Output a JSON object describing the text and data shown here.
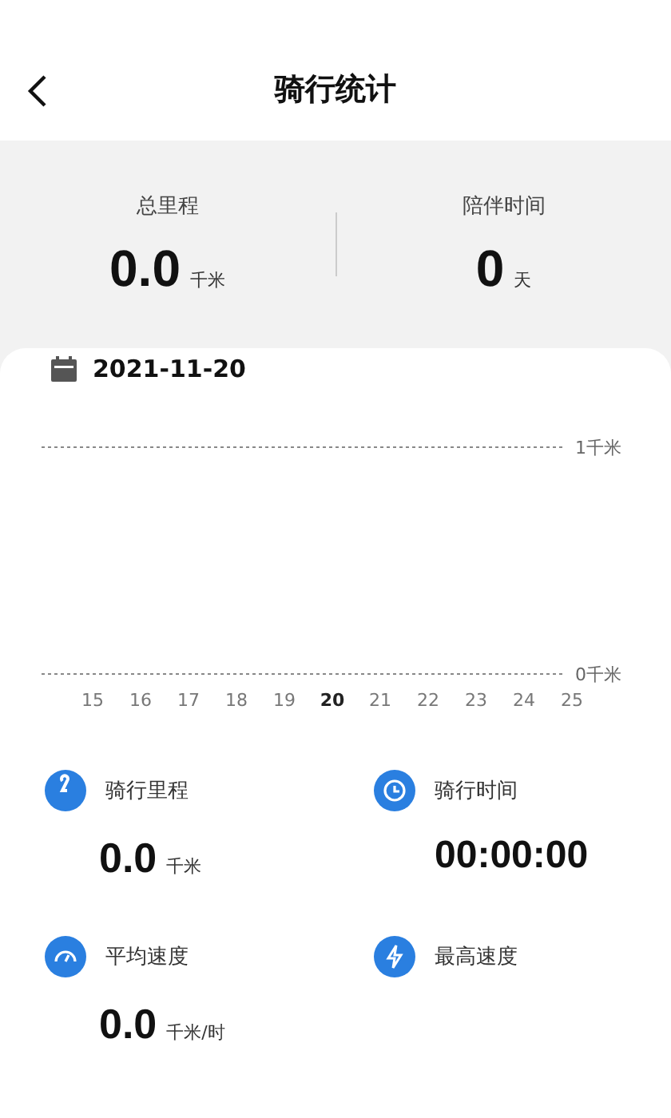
{
  "header": {
    "title": "骑行统计"
  },
  "summary": [
    {
      "label": "总里程",
      "value": "0.0",
      "unit": "千米"
    },
    {
      "label": "陪伴时间",
      "value": "0",
      "unit": "天"
    }
  ],
  "date": "2021-11-20",
  "chart": {
    "chart_data": {
      "type": "bar",
      "categories": [
        "15",
        "16",
        "17",
        "18",
        "19",
        "20",
        "21",
        "22",
        "23",
        "24",
        "25"
      ],
      "values": [
        null,
        null,
        null,
        null,
        null,
        null,
        null,
        null,
        null,
        null,
        null
      ],
      "ylim": [
        0,
        1
      ],
      "yticks": [
        {
          "value": 0,
          "label": "0千米"
        },
        {
          "value": 1,
          "label": "1千米"
        }
      ]
    },
    "selected": [
      false,
      false,
      false,
      false,
      false,
      true,
      false,
      false,
      false,
      false,
      false
    ]
  },
  "stats": [
    {
      "kind": "distance",
      "label": "骑行里程",
      "value": "0.0",
      "unit": "千米"
    },
    {
      "kind": "time",
      "label": "骑行时间",
      "value": "00:00:00"
    },
    {
      "kind": "speed",
      "label": "平均速度",
      "value": "0.0",
      "unit": "千米/时"
    },
    {
      "kind": "bolt",
      "label": "最高速度"
    }
  ]
}
